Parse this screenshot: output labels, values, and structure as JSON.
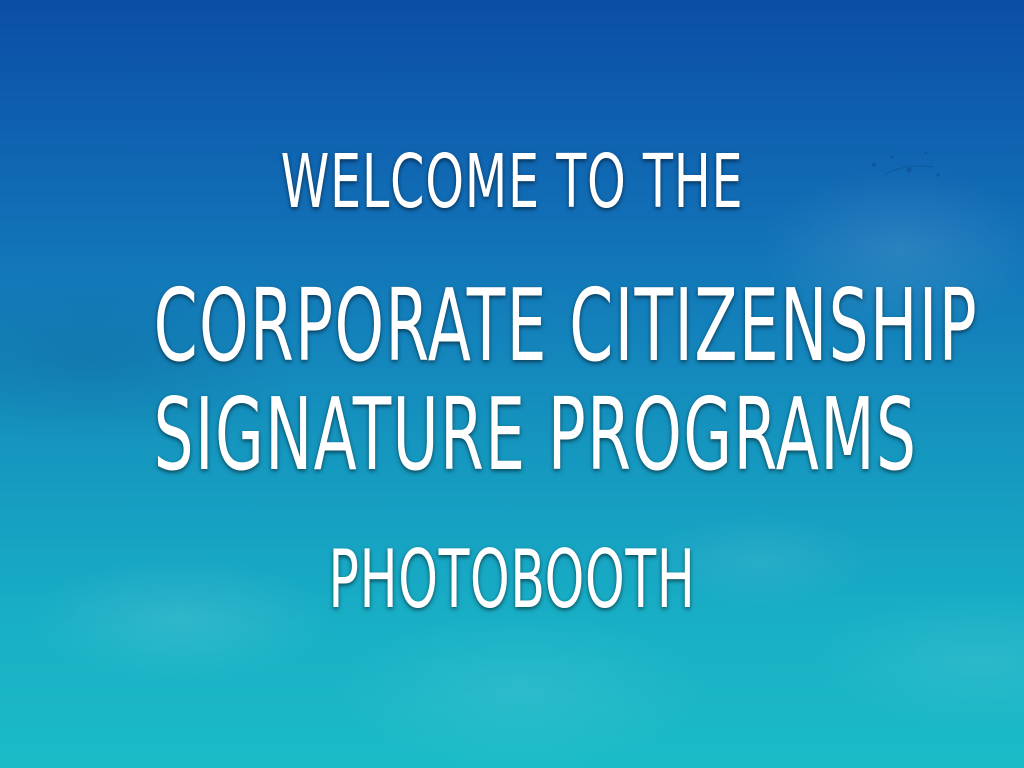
{
  "screen": {
    "line1": "WELCOME TO THE",
    "line2": "CORPORATE CITIZENSHIP",
    "line3": "SIGNATURE PROGRAMS",
    "line4": "PHOTOBOOTH"
  },
  "colors": {
    "background_top": "#0b4da6",
    "background_bottom": "#1bbcc8",
    "text": "#ffffff"
  }
}
